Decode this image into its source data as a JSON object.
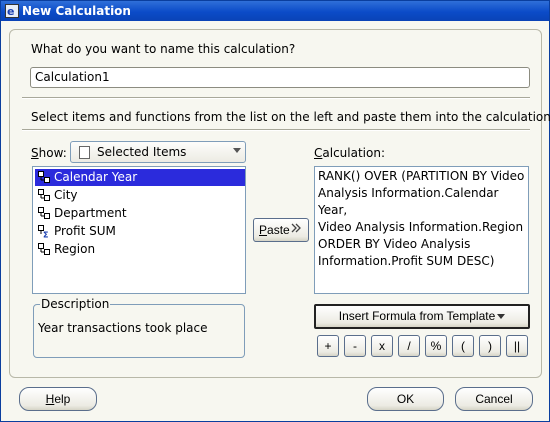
{
  "window": {
    "title": "New Calculation"
  },
  "name_prompt": "What do you want to name this calculation?",
  "name_field": {
    "value": "Calculation1"
  },
  "instructions": "Select items and functions from the list on the left and paste them into the calculation.",
  "show": {
    "label": "Show:",
    "selected": "Selected Items"
  },
  "items": [
    {
      "label": "Calendar Year",
      "icon": "dimension-icon",
      "selected": true
    },
    {
      "label": "City",
      "icon": "dimension-icon",
      "selected": false
    },
    {
      "label": "Department",
      "icon": "dimension-icon",
      "selected": false
    },
    {
      "label": "Profit SUM",
      "icon": "measure-sum-icon",
      "selected": false
    },
    {
      "label": "Region",
      "icon": "dimension-icon",
      "selected": false
    }
  ],
  "paste_button": "Paste",
  "calculation": {
    "label": "Calculation:",
    "lines": [
      "RANK() OVER (PARTITION BY Video",
      "Analysis Information.Calendar Year,",
      "Video Analysis Information.Region",
      "ORDER BY Video Analysis",
      "Information.Profit SUM DESC)"
    ]
  },
  "description": {
    "title": "Description",
    "text": "Year transactions took place"
  },
  "insert_formula_button": "Insert Formula from Template",
  "operators": [
    "+",
    "-",
    "x",
    "/",
    "%",
    "(",
    ")",
    "||"
  ],
  "footer": {
    "help": "Help",
    "ok": "OK",
    "cancel": "Cancel"
  },
  "colors": {
    "title_bar": "#0b4bc8",
    "selection": "#2b2bdc",
    "dialog_bg": "#f7f7f0"
  }
}
